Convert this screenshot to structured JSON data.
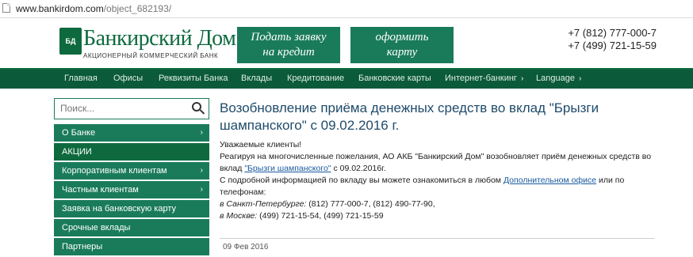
{
  "address_bar": {
    "domain": "www.bankirdom.com",
    "path": "/object_682193/"
  },
  "header": {
    "logo_text": "Банкирский Дом",
    "logo_emblem": "БД",
    "logo_subtitle": "АКЦИОНЕРНЫЙ КОММЕРЧЕСКИЙ БАНК",
    "cta_apply_line1": "Подать заявку",
    "cta_apply_line2": "на кредит",
    "cta_card_line1": "оформить",
    "cta_card_line2": "карту",
    "phone1": "+7 (812) 777-000-7",
    "phone2": "+7 (499) 721-15-59"
  },
  "nav": {
    "items": [
      "Главная",
      "Офисы",
      "Реквизиты Банка",
      "Вклады",
      "Кредитование",
      "Банковские карты",
      "Интернет-банкинг",
      "Language"
    ],
    "arrow": "›"
  },
  "sidebar": {
    "search_placeholder": "Поиск...",
    "items": [
      "О Банке",
      "АКЦИИ",
      "Корпоративным клиентам",
      "Частным клиентам",
      "Заявка на банковскую карту",
      "Срочные вклады",
      "Партнеры"
    ],
    "chevron": "›"
  },
  "article": {
    "title_line1": "Возобновление приёма денежных средств во вклад \"Брызги",
    "title_line2": "шампанского\" с 09.02.2016 г.",
    "greeting": "Уважаемые клиенты!",
    "p1_part1": "Реагируя на многочисленные пожелания, АО АКБ \"Банкирский Дом\" возобновляет приём денежных средств во",
    "p1_part2": "вклад ",
    "p1_link": "\"Брызги шампанского\"",
    "p1_part3": " с 09.02.2016г.",
    "p2_part1": "С подробной информацией по вкладу вы можете ознакомиться в любом ",
    "p2_link": "Дополнительном офисе",
    "p2_part2": " или по",
    "p2_part3": "телефонам:",
    "spb_label": "в Санкт-Петербурге:",
    "spb_phones": "  (812) 777-000-7, (812) 490-77-90,",
    "msk_label": "в Москве:",
    "msk_phones": " (499) 721-15-54, (499) 721-15-59",
    "date": "09 Фев 2016"
  },
  "colors": {
    "brand_green": "#0e6a3e",
    "menu_green": "#1a7b5b",
    "nav_green": "#0b5a3a",
    "title_blue": "#1f4a6a",
    "link_blue": "#1a5aa0"
  }
}
